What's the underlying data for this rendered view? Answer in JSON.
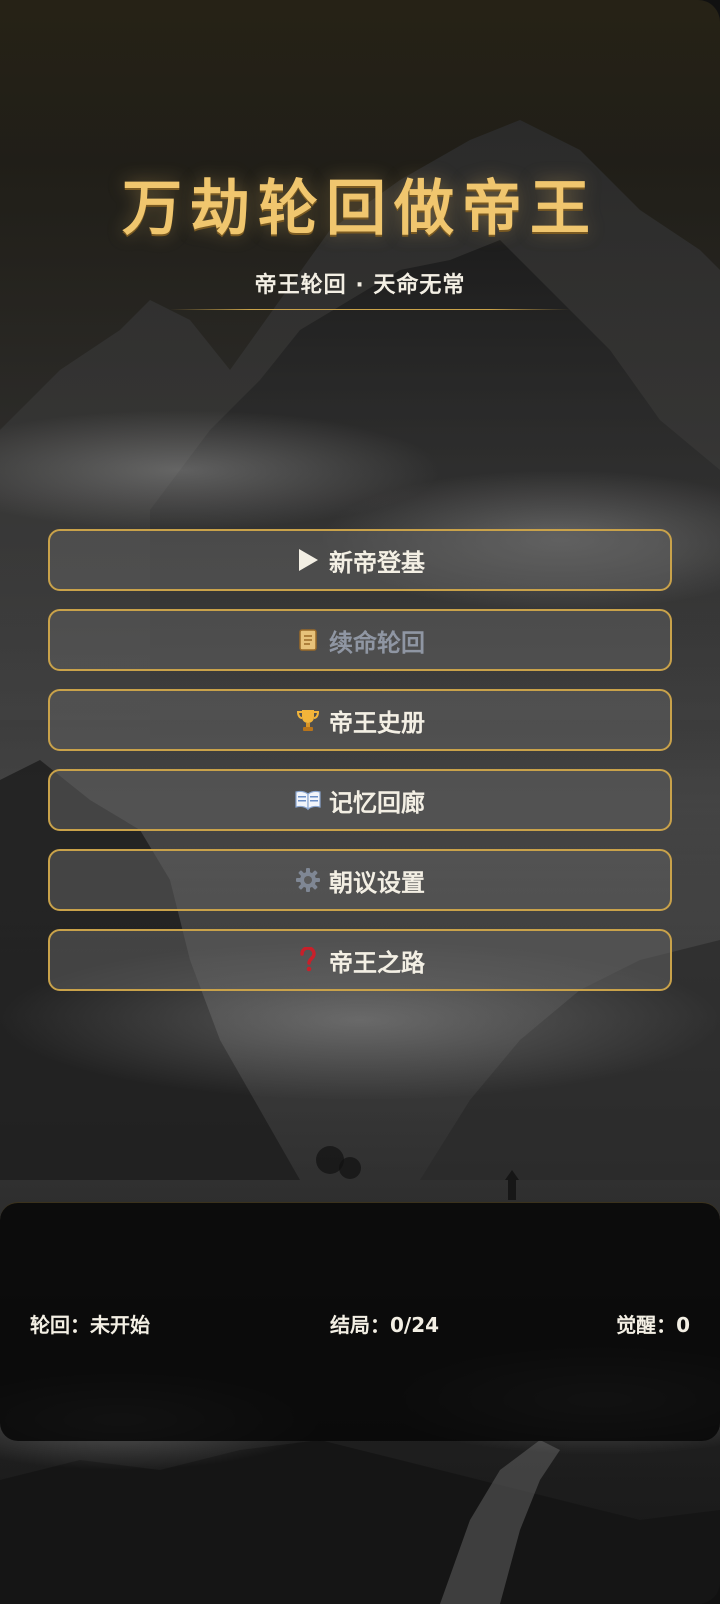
{
  "header": {
    "title": "万劫轮回做帝王",
    "subtitle": "帝王轮回 · 天命无常"
  },
  "menu": {
    "items": [
      {
        "label": "新帝登基",
        "icon": "play-icon"
      },
      {
        "label": "续命轮回",
        "icon": "scroll-icon",
        "disabled": true
      },
      {
        "label": "帝王史册",
        "icon": "trophy-icon"
      },
      {
        "label": "记忆回廊",
        "icon": "book-icon"
      },
      {
        "label": "朝议设置",
        "icon": "gear-icon"
      },
      {
        "label": "帝王之路",
        "icon": "question-icon"
      }
    ]
  },
  "stats": {
    "cycle": "轮回：未开始",
    "endings": "结局：0/24",
    "awakening": "觉醒：0"
  },
  "colors": {
    "accent_gold": "#c9a24a",
    "title_gold": "#f0c66e",
    "disabled_text": "#8f96a3",
    "question_red": "#c8202a"
  }
}
